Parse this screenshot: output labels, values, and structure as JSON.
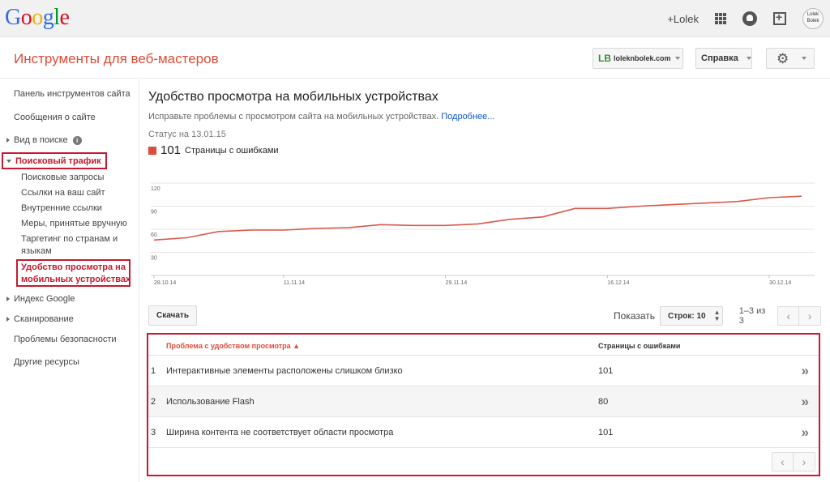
{
  "gbar": {
    "logo_letters": [
      "G",
      "o",
      "o",
      "g",
      "l",
      "e"
    ],
    "logo_colors": [
      "#3369e8",
      "#d50f25",
      "#eeb211",
      "#3369e8",
      "#009925",
      "#d50f25"
    ],
    "plus_user": "+Lolek",
    "avatar_text": "Lolek Bolek",
    "icons": [
      "apps-icon",
      "bell-icon",
      "share-icon"
    ]
  },
  "header": {
    "title": "Инструменты для веб-мастеров",
    "site_logo": "LB",
    "site_name": "loleknbolek.com",
    "help_label": "Справка",
    "accent": "#dd4b39"
  },
  "sidebar": {
    "items": [
      "Панель инструментов сайта",
      "Сообщения о сайте",
      "Вид в поиске",
      "Поисковый трафик",
      "Индекс Google",
      "Сканирование",
      "Проблемы безопасности",
      "Другие ресурсы"
    ],
    "traffic_subitems": [
      "Поисковые запросы",
      "Ссылки на ваш сайт",
      "Внутренние ссылки",
      "Меры, принятые вручную",
      "Таргетинг по странам и языкам",
      "Удобство просмотра на мобильных устройствах"
    ]
  },
  "main": {
    "title": "Удобство просмотра на мобильных устройствах",
    "description": "Исправьте проблемы с просмотром сайта на мобильных устройствах.",
    "more_link": "Подробнее...",
    "status": "Статус на 13.01.15",
    "legend_value": "101",
    "legend_label": "Страницы с ошибками",
    "download_label": "Скачать",
    "show_label": "Показать",
    "rows_label": "Строк: 10",
    "range": "1–3 из 3",
    "prev_icon": "‹",
    "next_icon": "›"
  },
  "chart_data": {
    "type": "line",
    "y_ticks": [
      120,
      90,
      60,
      30
    ],
    "ylim": [
      0,
      120
    ],
    "x_tick_labels": [
      "28.10.14",
      "11.11.14",
      "29.11.14",
      "16.12.14",
      "30.12.14"
    ],
    "x_tick_index": [
      0,
      4,
      9,
      14,
      19
    ],
    "series": [
      {
        "color": "#d9584a",
        "values": [
          46,
          49,
          57,
          59,
          59,
          61,
          62,
          66,
          65,
          65,
          67,
          73,
          76,
          87,
          87,
          90,
          92,
          94,
          96,
          101,
          103
        ]
      }
    ]
  },
  "table": {
    "col_issue": "Проблема с удобством просмотра ▲",
    "col_pages": "Страницы с ошибками",
    "rows": [
      {
        "idx": "1",
        "issue": "Интерактивные элементы расположены слишком близко",
        "pages": "101"
      },
      {
        "idx": "2",
        "issue": "Использование Flash",
        "pages": "80"
      },
      {
        "idx": "3",
        "issue": "Ширина контента не соответствует области просмотра",
        "pages": "101"
      }
    ],
    "row_arrow": "»"
  }
}
